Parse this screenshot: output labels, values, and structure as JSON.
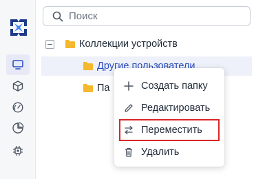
{
  "search": {
    "placeholder": "Поиск",
    "value": ""
  },
  "sidebar": {
    "logo": "logo-icon",
    "items": [
      {
        "icon": "monitor-icon",
        "active": true
      },
      {
        "icon": "cube-icon",
        "active": false
      },
      {
        "icon": "speedometer-icon",
        "active": false
      },
      {
        "icon": "pie-chart-icon",
        "active": false
      },
      {
        "icon": "chip-icon",
        "active": false
      }
    ]
  },
  "tree": {
    "root": {
      "label": "Коллекции устройств",
      "expanded": true
    },
    "children": [
      {
        "label": "Другие пользователи",
        "selected": true
      },
      {
        "label": "Па",
        "selected": false
      }
    ]
  },
  "context_menu": {
    "items": [
      {
        "label": "Создать папку",
        "icon": "plus-icon"
      },
      {
        "label": "Редактировать",
        "icon": "pencil-icon"
      },
      {
        "label": "Переместить",
        "icon": "move-arrows-icon",
        "highlighted": true
      },
      {
        "label": "Удалить",
        "icon": "trash-icon"
      }
    ]
  },
  "colors": {
    "accent": "#2c4fc4",
    "folder": "#f5b82e",
    "highlight_border": "#dc2626",
    "selected_row": "#eef1f9"
  }
}
